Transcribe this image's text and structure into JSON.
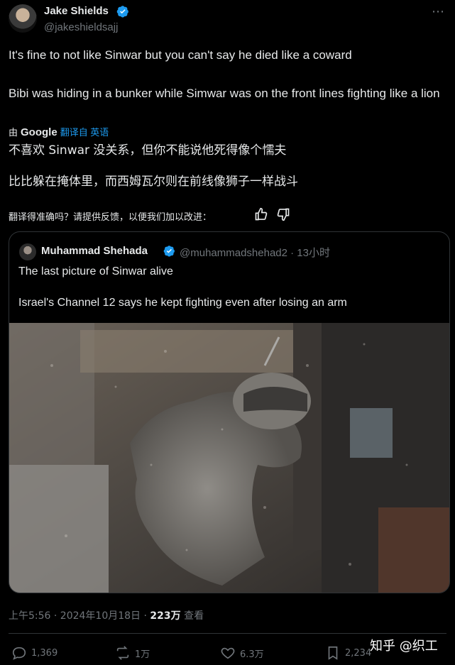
{
  "author": {
    "name": "Jake Shields",
    "handle": "@jakeshieldsajj",
    "avatar_icon": "avatar-photo",
    "more_icon": "more-icon"
  },
  "tweet": {
    "para1": "It's fine to not like Sinwar but you can't say he died like a coward",
    "para2": "Bibi was hiding in a bunker while Simwar was on the front lines fighting like a lion"
  },
  "translation": {
    "by_prefix": "由",
    "provider": "Google",
    "by_suffix": "翻译自 英语",
    "para1": "不喜欢 Sinwar 没关系，但你不能说他死得像个懦夫",
    "para2": "比比躲在掩体里，而西姆瓦尔则在前线像狮子一样战斗",
    "feedback": "翻译得准确吗？请提供反馈，以便我们加以改进："
  },
  "quote": {
    "name": "Muhammad Shehada",
    "handle": "@muhammadshehad2 · 13小时",
    "text1": "The last picture of Sinwar alive",
    "text2": "Israel's Channel 12 says he kept fighting even after losing an arm"
  },
  "meta": {
    "time": "上午5:56 · 2024年10月18日 · ",
    "views_count": "223万",
    "views_label": " 查看"
  },
  "actions": {
    "replies": "1,369",
    "reposts": "1万",
    "likes": "6.3万",
    "bookmarks": "2,234"
  },
  "watermark": "知乎 @织工",
  "colors": {
    "background": "#000000",
    "text": "#e7e9ea",
    "muted": "#71767b",
    "accent": "#1d9bf0",
    "border": "#2f3336"
  }
}
